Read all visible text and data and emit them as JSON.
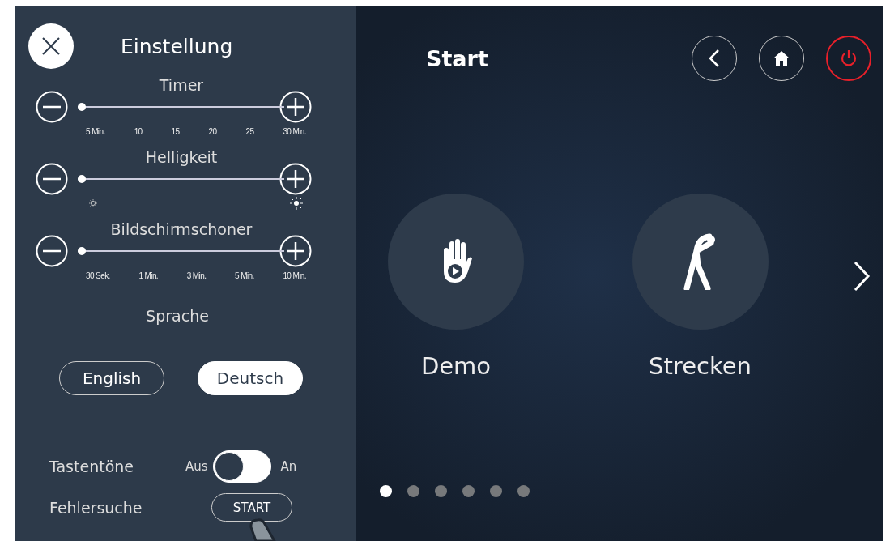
{
  "settings": {
    "title": "Einstellung",
    "sliders": [
      {
        "label": "Timer",
        "kind": "ticks",
        "level": 0,
        "ticks": [
          "5 Min.",
          "10",
          "15",
          "20",
          "25",
          "30 Min."
        ]
      },
      {
        "label": "Helligkeit",
        "kind": "icons",
        "level": 0
      },
      {
        "label": "Bildschirmschoner",
        "kind": "ticks",
        "level": 0,
        "ticks": [
          "30 Sek.",
          "1 Min.",
          "3 Min.",
          "5 Min.",
          "10 Min."
        ]
      }
    ],
    "language": {
      "label": "Sprache",
      "options": [
        {
          "label": "English",
          "selected": false
        },
        {
          "label": "Deutsch",
          "selected": true
        }
      ]
    },
    "key_tones": {
      "label": "Tastentöne",
      "off_label": "Aus",
      "on_label": "An",
      "on": false
    },
    "troubleshooting": {
      "label": "Fehlersuche",
      "button": "START"
    }
  },
  "main": {
    "title": "Start",
    "tiles": [
      {
        "label": "Demo",
        "kind": "demo"
      },
      {
        "label": "Strecken",
        "kind": "stretch"
      }
    ],
    "pages": [
      {
        "selected": true
      },
      {
        "selected": false
      },
      {
        "selected": false
      },
      {
        "selected": false
      },
      {
        "selected": false
      },
      {
        "selected": false
      }
    ]
  }
}
